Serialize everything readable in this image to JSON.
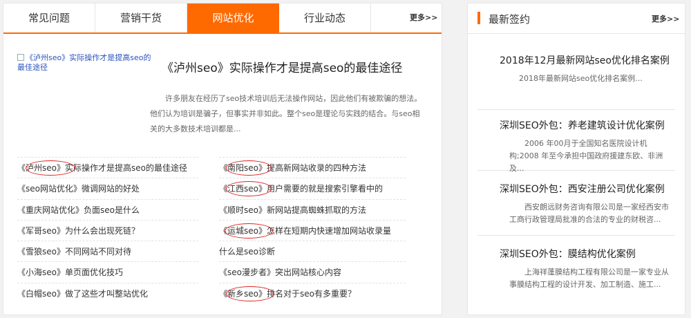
{
  "tabs": [
    {
      "label": "常见问题"
    },
    {
      "label": "营销干货"
    },
    {
      "label": "网站优化"
    },
    {
      "label": "行业动态"
    }
  ],
  "more_label": "更多>>",
  "feature": {
    "image_alt": "《泸州seo》实际操作才是提高seo的最佳途径",
    "title": "《泸州seo》实际操作才是提高seo的最佳途径",
    "description": "许多朋友在经历了seo技术培训后无法操作网站，因此他们有被欺骗的想法。他们认为培训是骗子，但事实并非如此。整个seo是理论与实践的结合。与seo相关的大多数技术培训都是..."
  },
  "articles_left": [
    "《泸州seo》实际操作才是提高seo的最佳途径",
    "《seo网站优化》微调网站的好处",
    "《重庆网站优化》负面seo是什么",
    "《军哥seo》为什么会出现死链？",
    "《雪狼seo》不同网站不同对待",
    "《小海seo》单页面优化技巧",
    "《白帽seo》做了这些才叫整站优化"
  ],
  "articles_right": [
    "《南阳seo》提高新网站收录的四种方法",
    "《江西seo》用户需要的就是搜索引擎看中的",
    "《顺时seo》新网站提高蜘蛛抓取的方法",
    "《运城seo》怎样在短期内快速增加网站收录量",
    "什么是seo诊断",
    "《seo漫步者》突出网站核心内容",
    "《新乡seo》排名对于seo有多重要？"
  ],
  "sidebar": {
    "title": "最新签约",
    "cases": [
      {
        "title": "2018年12月最新网站seo优化排名案例",
        "desc": "2018年最新网站seo优化排名案例..."
      },
      {
        "title": "深圳SEO外包：养老建筑设计优化案例",
        "desc": "2006 年00月于全国知名医院设计机构;2008 年至今承担中国政府援建东欧、非洲及..."
      },
      {
        "title": "深圳SEO外包：西安注册公司优化案例",
        "desc": "西安朗远财务咨询有限公司是一家经西安市工商行政管理局批准的合法的专业的财税咨..."
      },
      {
        "title": "深圳SEO外包：膜结构优化案例",
        "desc": "上海祥蓬膜结构工程有限公司是一家专业从事膜结构工程的设计开发、加工制造、施工..."
      }
    ]
  },
  "colors": {
    "accent": "#ff6a00",
    "ring": "#e02020"
  }
}
